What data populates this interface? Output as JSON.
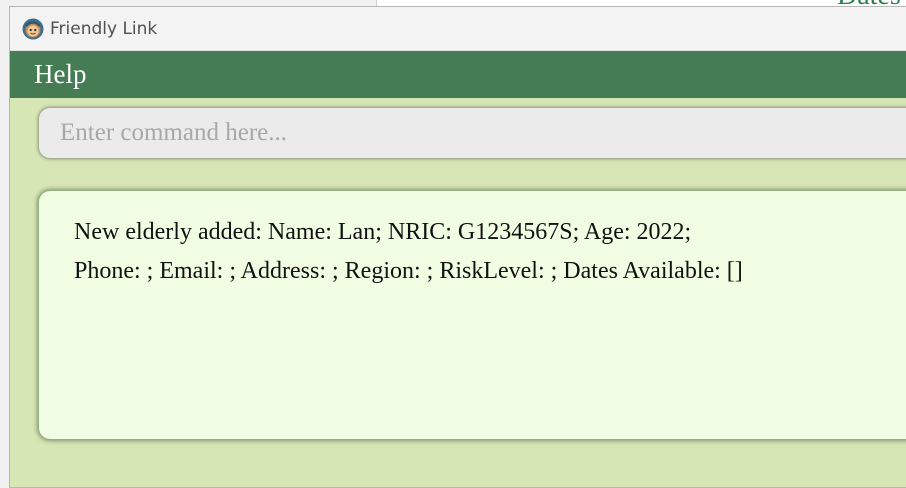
{
  "window": {
    "title": "Friendly Link",
    "icon": "monkey-avatar-icon"
  },
  "background_window": {
    "partial_text": "Dates"
  },
  "menu": {
    "items": [
      {
        "label": "Help"
      }
    ]
  },
  "command": {
    "value": "",
    "placeholder": "Enter command here..."
  },
  "result": {
    "line1": "New elderly added: Name: Lan; NRIC: G1234567S; Age: 2022;",
    "line2": "Phone: ; Email: ; Address: ; Region: ; RiskLevel: ; Dates Available: []"
  },
  "colors": {
    "menubar": "#457c53",
    "window_bg": "#d6e6b4",
    "result_bg": "#f0fde3"
  }
}
